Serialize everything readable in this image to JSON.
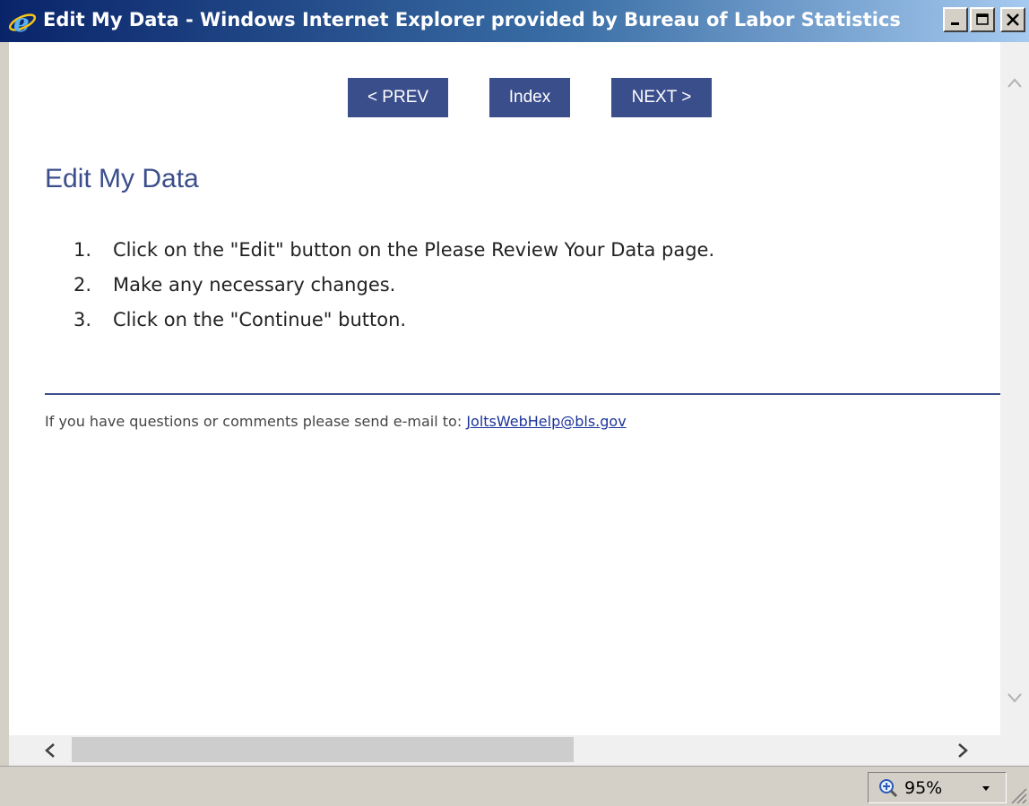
{
  "window": {
    "title": "Edit My Data - Windows Internet Explorer provided by Bureau of Labor Statistics",
    "icon": "internet-explorer-icon"
  },
  "nav": {
    "prev_label": "< PREV",
    "index_label": "Index",
    "next_label": "NEXT >"
  },
  "page": {
    "title": "Edit My Data",
    "steps": [
      {
        "num": "1.",
        "text": "Click on the \"Edit\" button on the Please Review Your Data page."
      },
      {
        "num": "2.",
        "text": "Make any necessary changes."
      },
      {
        "num": "3.",
        "text": "Click on the \"Continue\" button."
      }
    ],
    "footer_text": "If you have questions or comments please send e-mail to: ",
    "footer_email": "JoltsWebHelp@bls.gov"
  },
  "status": {
    "zoom": "95%"
  },
  "colors": {
    "accent": "#3b4e8c",
    "link": "#1a3399"
  }
}
